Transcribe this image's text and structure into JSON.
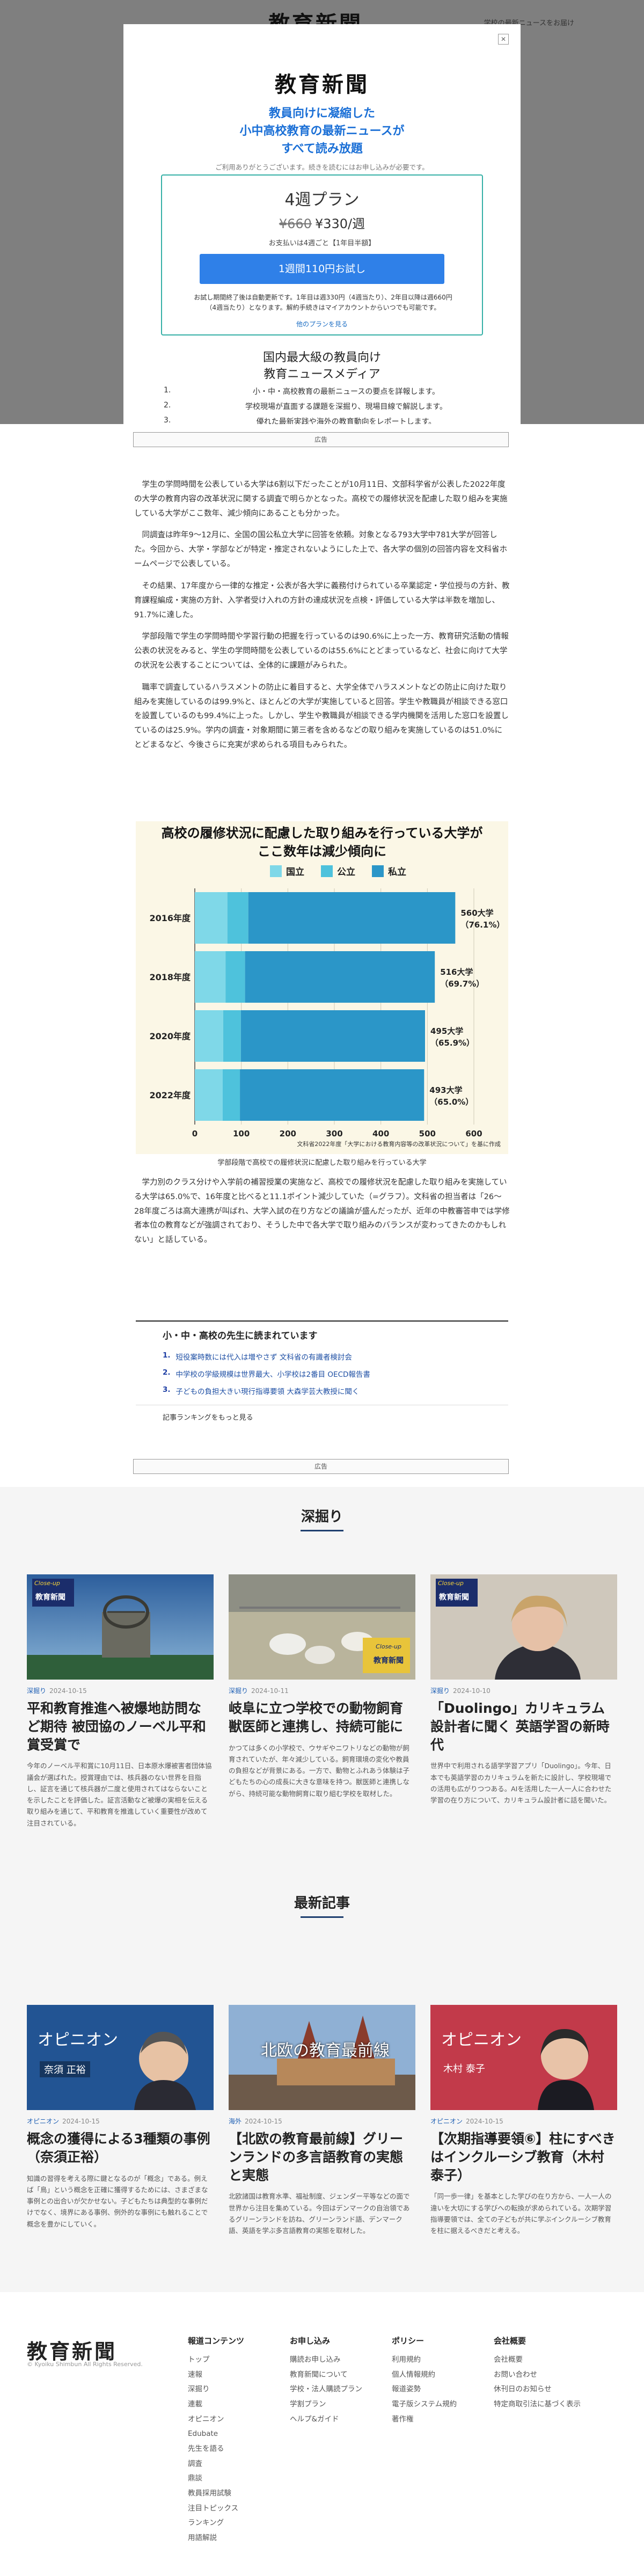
{
  "masthead": {
    "logo": "教育新聞",
    "bg_link": "学校の最新ニュースをお届け"
  },
  "ad_label": "広告",
  "article": {
    "paragraphs": [
      "学生の学問時間を公表している大学は6割以下だったことが10月11日、文部科学省が公表した2022年度の大学の教育内容の改革状況に関する調査で明らかとなった。高校での履修状況を配慮した取り組みを実施している大学がここ数年、減少傾向にあることも分かった。",
      "同調査は昨年9〜12月に、全国の国公私立大学に回答を依頼。対象となる793大学中781大学が回答した。今回から、大学・学部などが特定・推定されないようにした上で、各大学の個別の回答内容を文科省ホームページで公表している。",
      "その結果、17年度から一律的な推定・公表が各大学に義務付けられている卒業認定・学位授与の方針、教育課程編成・実施の方針、入学者受け入れの方針の達成状況を点検・評価している大学は半数を増加し、91.7%に達した。",
      "学部段階で学生の学問時間や学習行動の把握を行っているのは90.6%に上った一方、教育研究活動の情報公表の状況をみると、学生の学問時間を公表しているのは55.6%にとどまっているなど、社会に向けて大学の状況を公表することについては、全体的に課題がみられた。",
      "職率で調査しているハラスメントの防止に着目すると、大学全体でハラスメントなどの防止に向けた取り組みを実施しているのは99.9%と、ほとんどの大学が実施していると回答。学生や教職員が相談できる窓口を設置しているのも99.4%に上った。しかし、学生や教職員が相談できる学内機関を活用した窓口を設置しているのは25.9%。学内の調査・対象期間に第三者を含めるなどの取り組みを実施しているのは51.0%にとどまるなど、今後さらに充実が求められる項目もみられた。"
    ],
    "para_after": "学力別のクラス分けや入学前の補習授業の実施など、高校での履修状況を配慮した取り組みを実施している大学は65.0%で、16年度と比べると11.1ポイント減少していた（=グラフ）。文科省の担当者は「26〜28年度ごろは高大連携が叫ばれ、大学入試の在り方などの議論が盛んだったが、近年の中教審答申では学修者本位の教育などが強調されており、そうした中で各大学で取り組みのバランスが変わってきたのかもしれない」と話している。",
    "figure_caption": "学部段階で高校での履修状況に配慮した取り組みを行っている大学"
  },
  "chart_data": {
    "type": "bar",
    "title": "高校の履修状況に配慮した取り組みを行っている大学が\nここ数年は減少傾向に",
    "legend": [
      "国立",
      "公立",
      "私立"
    ],
    "colors": {
      "national": "#7fd8e8",
      "public": "#4ec2dc",
      "private": "#2b96c8",
      "bg": "#fbf7e6"
    },
    "categories": [
      "2016年度",
      "2018年度",
      "2020年度",
      "2022年度"
    ],
    "series": [
      {
        "name": "国立",
        "values": [
          70,
          66,
          61,
          60
        ]
      },
      {
        "name": "公立",
        "values": [
          45,
          42,
          38,
          37
        ]
      },
      {
        "name": "私立",
        "values": [
          445,
          408,
          396,
          396
        ]
      }
    ],
    "totals": [
      560,
      516,
      495,
      493
    ],
    "total_labels": [
      "560大学\n（76.1%）",
      "516大学\n（69.7%）",
      "495大学\n（65.9%）",
      "493大学\n（65.0%）"
    ],
    "xlim": [
      0,
      600
    ],
    "xticks": [
      0,
      100,
      200,
      300,
      400,
      500,
      600
    ],
    "source": "文科省2022年度「大学における教育内容等の改革状況について」を基に作成"
  },
  "read_box": {
    "heading": "小・中・高校の先生に読まれています",
    "items": [
      "短役案時数には代入は増やさず 文科省の有識者検討会",
      "中学校の学級規模は世界最大、小学校は2番目 OECD報告書",
      "子どもの負担大きい現行指導要領 大森学芸大教授に聞く"
    ],
    "more": "記事ランキングをもっと見る"
  },
  "fukabori": {
    "title": "深掘り",
    "cards": [
      {
        "category": "深掘り",
        "date": "2024-10-15",
        "thumb_badge": "Close-up",
        "thumb_logo": "教育新聞",
        "title": "平和教育推進へ被爆地訪問など期待 被団協のノーベル平和賞受賞で",
        "excerpt": "今年のノーベル平和賞に10月11日、日本原水爆被害者団体協議会が選ばれた。授賞理由では、核兵器のない世界を目指し、証言を通じて核兵器が二度と使用されてはならないことを示したことを評価した。証言活動など被爆の実相を伝える取り組みを通じて、平和教育を推進していく重要性が改めて注目されている。"
      },
      {
        "category": "深掘り",
        "date": "2024-10-11",
        "thumb_badge": "Close-up",
        "thumb_logo": "教育新聞",
        "title": "岐阜に立つ学校での動物飼育 獣医師と連携し、持続可能に",
        "excerpt": "かつては多くの小学校で、ウサギやニワトリなどの動物が飼育されていたが、年々減少している。飼育環境の変化や教員の負担などが背景にある。一方で、動物とふれあう体験は子どもたちの心の成長に大きな意味を持つ。獣医師と連携しながら、持続可能な動物飼育に取り組む学校を取材した。"
      },
      {
        "category": "深掘り",
        "date": "2024-10-10",
        "thumb_badge": "Close-up",
        "thumb_logo": "教育新聞",
        "title": "「Duolingo」カリキュラム設計者に聞く 英語学習の新時代",
        "excerpt": "世界中で利用される語学学習アプリ「Duolingo」。今年、日本でも英語学習のカリキュラムを新たに設計し、学校現場での活用も広がりつつある。AIを活用した一人一人に合わせた学習の在り方について、カリキュラム設計者に話を聞いた。"
      }
    ]
  },
  "latest": {
    "title": "最新記事",
    "cards": [
      {
        "category": "オピニオン",
        "date": "2024-10-15",
        "thumb_text": "オピニオン",
        "thumb_sub": "奈須 正裕",
        "title": "概念の獲得による3種類の事例（奈須正裕）",
        "excerpt": "知識の習得を考える際に鍵となるのが「概念」である。例えば「鳥」という概念を正確に獲得するためには、さまざまな事例との出合いが欠かせない。子どもたちは典型的な事例だけでなく、境界にある事例、例外的な事例にも触れることで概念を豊かにしていく。"
      },
      {
        "category": "海外",
        "date": "2024-10-15",
        "thumb_text": "北欧の教育最前線",
        "thumb_sub": "",
        "title": "【北欧の教育最前線】グリーンランドの多言語教育の実態と実態",
        "excerpt": "北欧諸国は教育水準、福祉制度、ジェンダー平等などの面で世界から注目を集めている。今回はデンマークの自治領であるグリーンランドを訪ね、グリーンランド語、デンマーク語、英語を学ぶ多言語教育の実態を取材した。"
      },
      {
        "category": "オピニオン",
        "date": "2024-10-15",
        "thumb_text": "オピニオン",
        "thumb_sub": "木村 泰子",
        "title": "【次期指導要領⑥】柱にすべきはインクルーシブ教育（木村泰子）",
        "excerpt": "「同一歩一律」を基本とした学びの在り方から、一人一人の違いを大切にする学びへの転換が求められている。次期学習指導要領では、全ての子どもが共に学ぶインクルーシブ教育を柱に据えるべきだと考える。"
      }
    ]
  },
  "footer": {
    "logo": "教育新聞",
    "copyright": "© Kyoiku Shimbun All Rights Reserved.",
    "columns": [
      {
        "heading": "報道コンテンツ",
        "items": [
          "トップ",
          "速報",
          "深掘り",
          "連載",
          "オピニオン",
          "Edubate",
          "先生を語る",
          "調査",
          "鼎談",
          "教員採用試験",
          "注目トピックス",
          "ランキング",
          "用語解説"
        ]
      },
      {
        "heading": "お申し込み",
        "items": [
          "購読お申し込み",
          "教育新聞について",
          "学校・法人購読プラン",
          "学割プラン",
          "ヘルプ&ガイド"
        ]
      },
      {
        "heading": "ポリシー",
        "items": [
          "利用規約",
          "個人情報規約",
          "報道姿勢",
          "電子版システム規約",
          "著作権"
        ]
      },
      {
        "heading": "会社概要",
        "items": [
          "会社概要",
          "お問い合わせ",
          "休刊日のお知らせ",
          "特定商取引法に基づく表示"
        ]
      }
    ]
  },
  "modal": {
    "logo": "教育新聞",
    "tagline": "教員向けに凝縮した\n小中高校教育の最新ニュースが\nすべて読み放題",
    "thanks": "ご利用ありがとうございます。続きを読むにはお申し込みが必要です。",
    "plan_name": "4週プラン",
    "old_price": "¥660",
    "new_price": "¥330/週",
    "payment": "お支払いは4週ごと【1年目半額】",
    "cta": "1週間110円お試し",
    "fine_print": "お試し期間終了後は自動更新です。1年目は週330円（4週当たり）、2年目以降は週660円（4週当たり）となります。解約手続きはマイアカウントからいつでも可能です。",
    "other_plans": "他のプランを見る",
    "media_title": "国内最大級の教員向け\n教育ニュースメディア",
    "features": [
      {
        "n": "1.",
        "t": "小・中・高校教育の最新ニュースの要点を詳報します。"
      },
      {
        "n": "2.",
        "t": "学校現場が直面する課題を深掘り、現場目線で解説します。"
      },
      {
        "n": "3.",
        "t": "優れた最新実践や海外の教育動向をレポートします。"
      }
    ]
  }
}
